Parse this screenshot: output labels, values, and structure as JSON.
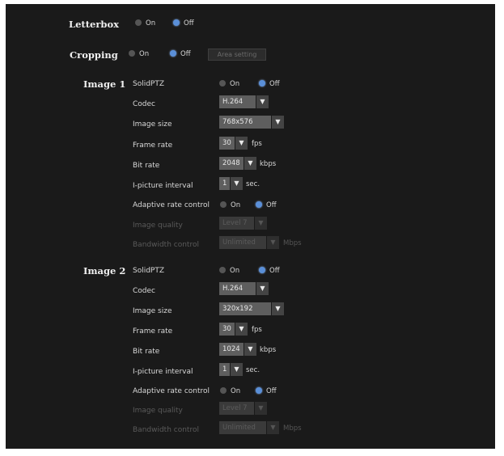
{
  "letterbox": {
    "label": "Letterbox",
    "on": "On",
    "off": "Off",
    "selected": "off"
  },
  "cropping": {
    "label": "Cropping",
    "on": "On",
    "off": "Off",
    "selected": "off",
    "area_button": "Area setting"
  },
  "image1": {
    "label": "Image 1",
    "solidptz": {
      "label": "SolidPTZ",
      "on": "On",
      "off": "Off",
      "selected": "off"
    },
    "codec": {
      "label": "Codec",
      "value": "H.264"
    },
    "image_size": {
      "label": "Image size",
      "value": "768x576"
    },
    "frame_rate": {
      "label": "Frame rate",
      "value": "30",
      "unit": "fps"
    },
    "bit_rate": {
      "label": "Bit rate",
      "value": "2048",
      "unit": "kbps"
    },
    "i_picture": {
      "label": "I-picture interval",
      "value": "1",
      "unit": "sec."
    },
    "adaptive": {
      "label": "Adaptive rate control",
      "on": "On",
      "off": "Off",
      "selected": "off"
    },
    "image_quality": {
      "label": "Image quality",
      "value": "Level 7"
    },
    "bandwidth": {
      "label": "Bandwidth control",
      "value": "Unlimited",
      "unit": "Mbps"
    }
  },
  "image2": {
    "label": "Image 2",
    "solidptz": {
      "label": "SolidPTZ",
      "on": "On",
      "off": "Off",
      "selected": "off"
    },
    "codec": {
      "label": "Codec",
      "value": "H.264"
    },
    "image_size": {
      "label": "Image size",
      "value": "320x192"
    },
    "frame_rate": {
      "label": "Frame rate",
      "value": "30",
      "unit": "fps"
    },
    "bit_rate": {
      "label": "Bit rate",
      "value": "1024",
      "unit": "kbps"
    },
    "i_picture": {
      "label": "I-picture interval",
      "value": "1",
      "unit": "sec."
    },
    "adaptive": {
      "label": "Adaptive rate control",
      "on": "On",
      "off": "Off",
      "selected": "off"
    },
    "image_quality": {
      "label": "Image quality",
      "value": "Level 7"
    },
    "bandwidth": {
      "label": "Bandwidth control",
      "value": "Unlimited",
      "unit": "Mbps"
    }
  },
  "colors": {
    "panel_bg": "#1a1a1a",
    "radio_selected": "#5a8fd8",
    "radio_unselected": "#555555"
  },
  "icons": {
    "dropdown": "chevron-down-icon",
    "radio": "radio-icon"
  }
}
